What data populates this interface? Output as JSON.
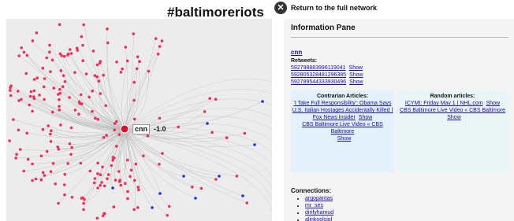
{
  "header": {
    "title": "#baltimoreriots",
    "back_label": "Return to the full network",
    "back_icon": "close-x-icon"
  },
  "graph": {
    "center_label": "cnn",
    "center_score": "-1.0",
    "colors": {
      "node_red": "#ef2e5b",
      "node_blue": "#1c2fe8",
      "center": "#e0102b",
      "edge": "#b8b8b8",
      "background": "#ececec"
    }
  },
  "pane": {
    "title": "Information Pane",
    "user": "cnn",
    "retweets_heading": "Retweets:",
    "show_label": "Show",
    "retweets": [
      "592798883996119041",
      "592805328481296385",
      "592789544333930496"
    ],
    "contrarian": {
      "heading": "Contrarian Articles:",
      "items": [
        "'I Take Full Responsibility': Obama Says U.S. Italian Hostages Accidentally Killed | Fox News Insider",
        "CBS Baltimore Live Video « CBS Baltimore"
      ]
    },
    "random": {
      "heading": "Random articles:",
      "items": [
        "ICYMI: Friday May 1 | NHL.com",
        "CBS Baltimore Live Video « CBS Baltimore"
      ]
    },
    "connections_heading": "Connections:",
    "connections": [
      "argopantas",
      "mr_ses",
      "dirifyhamud",
      "alinkoolsigl"
    ]
  }
}
